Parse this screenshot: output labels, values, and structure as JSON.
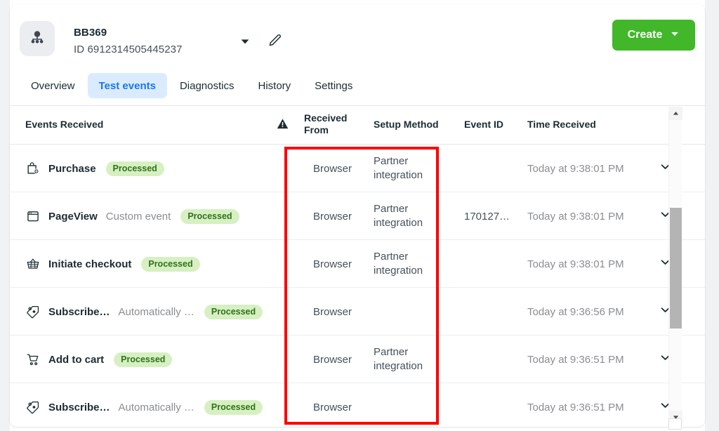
{
  "header": {
    "avatar_icon": "network-nodes-icon",
    "account_name": "BB369",
    "account_id": "ID 6912314505445237",
    "caret_icon": "chevron-down-icon",
    "edit_icon": "pencil-icon",
    "create_button": {
      "label": "Create",
      "caret_icon": "caret-down-icon",
      "color": "#42b72a"
    }
  },
  "tabs": [
    {
      "label": "Overview",
      "active": false
    },
    {
      "label": "Test events",
      "active": true
    },
    {
      "label": "Diagnostics",
      "active": false
    },
    {
      "label": "History",
      "active": false
    },
    {
      "label": "Settings",
      "active": false
    }
  ],
  "table": {
    "columns": {
      "events_received": "Events Received",
      "warning_icon": "warning-triangle-icon",
      "received_from": "Received From",
      "setup_method": "Setup Method",
      "event_id": "Event ID",
      "time_received": "Time Received"
    },
    "rows": [
      {
        "icon": "shopping-bag-icon",
        "event": "Purchase",
        "subtitle": "",
        "status": "Processed",
        "received_from": "Browser",
        "setup_method": "Partner integration",
        "event_id": "",
        "time_received": "Today at 9:38:01 PM",
        "expand_icon": "chevron-down-icon"
      },
      {
        "icon": "window-icon",
        "event": "PageView",
        "subtitle": "Custom event",
        "status": "Processed",
        "received_from": "Browser",
        "setup_method": "Partner integration",
        "event_id": "170127…",
        "time_received": "Today at 9:38:01 PM",
        "expand_icon": "chevron-down-icon"
      },
      {
        "icon": "basket-icon",
        "event": "Initiate checkout",
        "subtitle": "",
        "status": "Processed",
        "received_from": "Browser",
        "setup_method": "Partner integration",
        "event_id": "",
        "time_received": "Today at 9:38:01 PM",
        "expand_icon": "chevron-down-icon"
      },
      {
        "icon": "tag-icon",
        "event": "Subscribe…",
        "subtitle": "Automatically …",
        "status": "Processed",
        "received_from": "Browser",
        "setup_method": "",
        "event_id": "",
        "time_received": "Today at 9:36:56 PM",
        "expand_icon": "chevron-down-icon"
      },
      {
        "icon": "cart-icon",
        "event": "Add to cart",
        "subtitle": "",
        "status": "Processed",
        "received_from": "Browser",
        "setup_method": "Partner integration",
        "event_id": "",
        "time_received": "Today at 9:36:51 PM",
        "expand_icon": "chevron-down-icon"
      },
      {
        "icon": "tag-icon",
        "event": "Subscribe…",
        "subtitle": "Automatically …",
        "status": "Processed",
        "received_from": "Browser",
        "setup_method": "",
        "event_id": "",
        "time_received": "Today at 9:36:51 PM",
        "expand_icon": "chevron-down-icon"
      }
    ]
  },
  "scrollbar": {
    "up_icon": "scroll-up-arrow-icon",
    "down_icon": "scroll-down-arrow-icon"
  },
  "annotation": {
    "color": "#ff0000",
    "shape": "rectangle"
  }
}
